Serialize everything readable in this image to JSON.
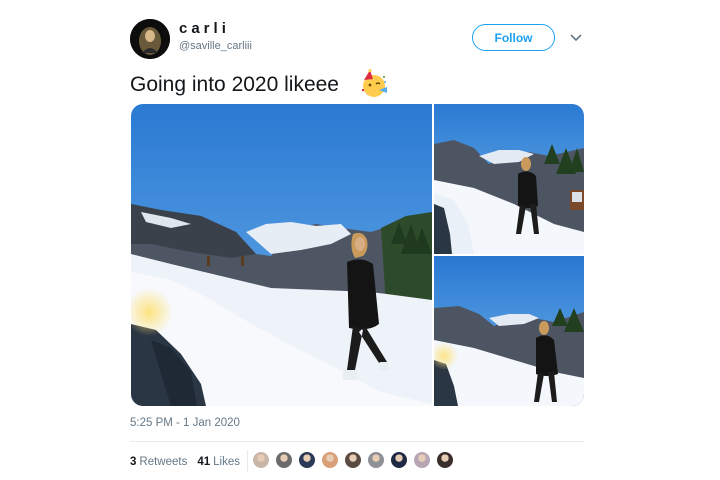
{
  "user": {
    "display_name": "carli",
    "handle": "@saville_carliii"
  },
  "follow_button": {
    "label": "Follow"
  },
  "tweet": {
    "text": "Going into 2020 likeee",
    "emoji": "party-face-emoji",
    "timestamp": "5:25 PM - 1 Jan 2020"
  },
  "stats": {
    "retweets_count": "3",
    "retweets_label": "Retweets",
    "likes_count": "41",
    "likes_label": "Likes"
  },
  "likers": [
    {
      "color": "#c9b6a8"
    },
    {
      "color": "#6b6b6b"
    },
    {
      "color": "#2b3a55"
    },
    {
      "color": "#d9a07a"
    },
    {
      "color": "#5a4a40"
    },
    {
      "color": "#8f8f96"
    },
    {
      "color": "#1f2a44"
    },
    {
      "color": "#b8a6b5"
    },
    {
      "color": "#3a2e2a"
    }
  ],
  "colors": {
    "accent": "#1da1f2",
    "text_secondary": "#657786",
    "sky": "#2f7fd6",
    "snow": "#f2f5fa"
  }
}
